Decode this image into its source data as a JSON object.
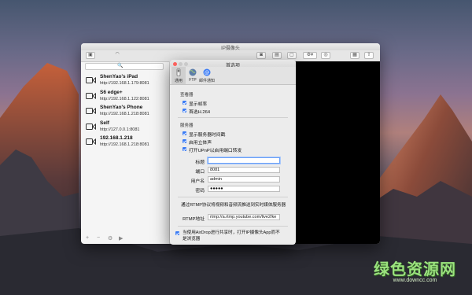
{
  "main_window": {
    "title": "IP摄像头",
    "search_placeholder": "🔍",
    "cameras": [
      {
        "name": "ShenYao's iPad",
        "url": "http://192.168.1.179:8081"
      },
      {
        "name": "S6 edge+",
        "url": "http://192.168.1.122:8081"
      },
      {
        "name": "ShenYao's Phone",
        "url": "http://192.168.1.218:8081"
      },
      {
        "name": "Self",
        "url": "http://127.0.0.1:8081"
      },
      {
        "name": "192.168.1.218",
        "url": "http://192.168.1.218:8081"
      }
    ],
    "bottom": {
      "add": "+",
      "remove": "−",
      "settings": "⚙",
      "play": "▶"
    }
  },
  "prefs": {
    "title": "首选项",
    "tabs": [
      {
        "label": "通用",
        "icon": "switch-icon"
      },
      {
        "label": "FTP",
        "icon": "globe-icon"
      },
      {
        "label": "邮件通知",
        "icon": "at-icon"
      }
    ],
    "section_viewer": "查看器",
    "viewer_options": [
      "显示帧率",
      "首选H.264"
    ],
    "section_server": "服务器",
    "server_options": [
      "显示服务器时间戳",
      "启用立体声",
      "打开UPnP以启用端口转发"
    ],
    "fields": {
      "title_label": "标题",
      "title_value": "",
      "port_label": "端口",
      "port_value": "8081",
      "user_label": "用户名",
      "user_value": "admin",
      "pass_label": "密码",
      "pass_value": "●●●●●"
    },
    "rtmp_note": "通过RTMP协议将视频和音频流推送到实时媒体服务器",
    "rtmp_label": "RTMP地址",
    "rtmp_value": "rtmp://a.rtmp.youtube.com/live2/ke",
    "airdrop_note": "当使用AirDrop进行共享时，打开IP摄像头App而不是浏览器"
  },
  "watermark": {
    "main": "绿色资源网",
    "sub": "www.downcc.com"
  },
  "colors": {
    "accent": "#3b7cf5",
    "preview_bg": "#000000"
  }
}
